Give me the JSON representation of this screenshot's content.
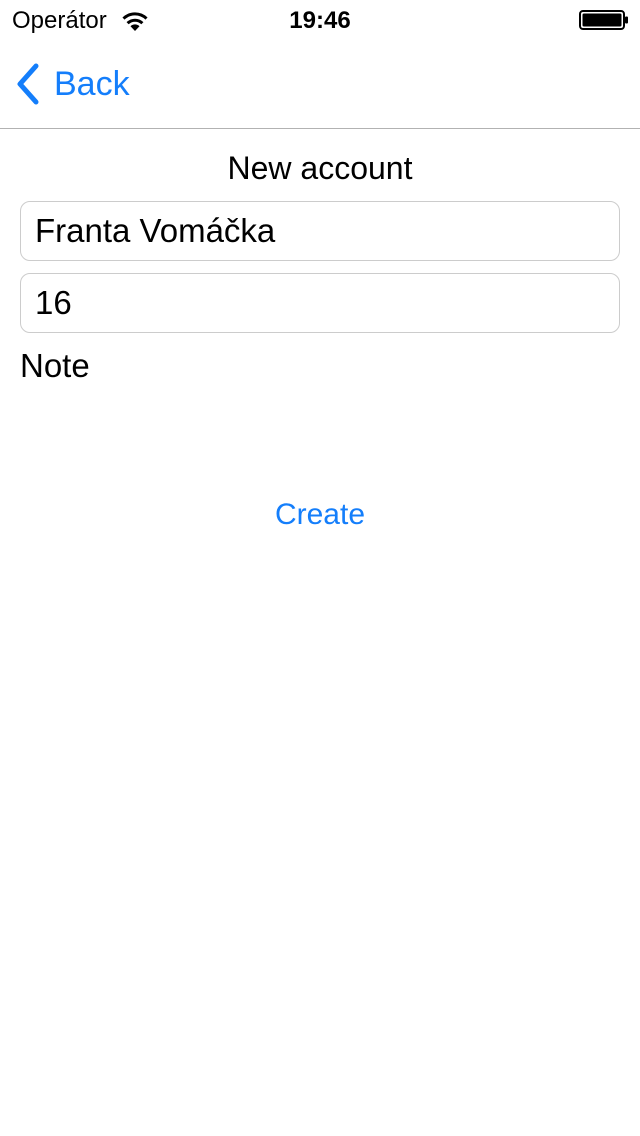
{
  "status_bar": {
    "carrier": "Operátor",
    "time": "19:46",
    "wifi_icon": "wifi-icon",
    "battery_icon": "battery-icon"
  },
  "nav": {
    "back_label": "Back",
    "back_icon": "chevron-left-icon"
  },
  "form": {
    "title": "New account",
    "name_value": "Franta Vomáčka",
    "number_value": "16",
    "note_label": "Note",
    "create_label": "Create"
  },
  "colors": {
    "accent": "#147efb",
    "field_border": "#cccccc",
    "separator": "#b2b2b2"
  }
}
